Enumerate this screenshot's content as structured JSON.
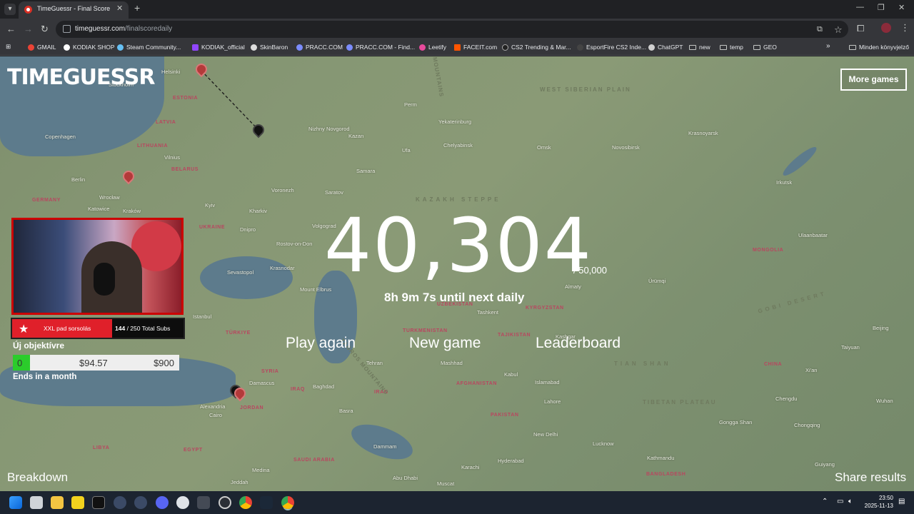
{
  "browser": {
    "tab_title": "TimeGuessr - Final Score",
    "url_host": "timeguessr.com",
    "url_path": "/finalscoredaily",
    "new_tab_icon": "plus-icon",
    "bookmarks": [
      {
        "label": "GMAIL",
        "icon": "gmail-icon"
      },
      {
        "label": "KODIAK SHOP",
        "icon": "shop-icon"
      },
      {
        "label": "Steam Community...",
        "icon": "steam-icon"
      },
      {
        "label": "KODIAK_official",
        "icon": "twitch-icon"
      },
      {
        "label": "SkinBaron",
        "icon": "skinbaron-icon"
      },
      {
        "label": "PRACC.COM",
        "icon": "pracc-icon"
      },
      {
        "label": "PRACC.COM - Find...",
        "icon": "pracc-icon"
      },
      {
        "label": "Leetify",
        "icon": "leetify-icon"
      },
      {
        "label": "FACEIT.com",
        "icon": "faceit-icon"
      },
      {
        "label": "CS2 Trending & Mar...",
        "icon": "cs2-icon"
      },
      {
        "label": "EsportFire CS2 Inde...",
        "icon": "esportfire-icon"
      },
      {
        "label": "ChatGPT",
        "icon": "chatgpt-icon"
      },
      {
        "label": "new",
        "icon": "folder-icon"
      },
      {
        "label": "temp",
        "icon": "folder-icon"
      },
      {
        "label": "GEO",
        "icon": "folder-icon"
      }
    ],
    "other_bookmarks": "Minden könyvjelző"
  },
  "page": {
    "logo": "TIMEGUESSR",
    "more_games": "More games",
    "score": "40,304",
    "score_max": "/ 50,000",
    "countdown": "8h 9m 7s until next daily",
    "actions": {
      "play_again": "Play again",
      "new_game": "New game",
      "leaderboard": "Leaderboard"
    },
    "breakdown": "Breakdown",
    "share": "Share results"
  },
  "map_labels": [
    {
      "text": "Helsinki",
      "kind": "city"
    },
    {
      "text": "Stockholm",
      "kind": "city"
    },
    {
      "text": "ESTONIA",
      "kind": "country"
    },
    {
      "text": "LATVIA",
      "kind": "country"
    },
    {
      "text": "LITHUANIA",
      "kind": "country"
    },
    {
      "text": "Vilnius",
      "kind": "city"
    },
    {
      "text": "Copenhagen",
      "kind": "city"
    },
    {
      "text": "Berlin",
      "kind": "city"
    },
    {
      "text": "BELARUS",
      "kind": "country"
    },
    {
      "text": "Wrocław",
      "kind": "city"
    },
    {
      "text": "Katowice",
      "kind": "city"
    },
    {
      "text": "Kraków",
      "kind": "city"
    },
    {
      "text": "GERMANY",
      "kind": "country"
    },
    {
      "text": "Kyiv",
      "kind": "city"
    },
    {
      "text": "Kharkiv",
      "kind": "city"
    },
    {
      "text": "UKRAINE",
      "kind": "country"
    },
    {
      "text": "Dnipro",
      "kind": "city"
    },
    {
      "text": "Rostov-on-Don",
      "kind": "city"
    },
    {
      "text": "Sevastopol",
      "kind": "city"
    },
    {
      "text": "Krasnodar",
      "kind": "city"
    },
    {
      "text": "Istanbul",
      "kind": "city"
    },
    {
      "text": "TÜRKIYE",
      "kind": "country"
    },
    {
      "text": "Mount Elbrus",
      "kind": "city"
    },
    {
      "text": "Nizhny Novgorod",
      "kind": "city"
    },
    {
      "text": "Kazan",
      "kind": "city"
    },
    {
      "text": "Perm",
      "kind": "city"
    },
    {
      "text": "Yekaterinburg",
      "kind": "city"
    },
    {
      "text": "Ufa",
      "kind": "city"
    },
    {
      "text": "Chelyabinsk",
      "kind": "city"
    },
    {
      "text": "Samara",
      "kind": "city"
    },
    {
      "text": "Voronezh",
      "kind": "city"
    },
    {
      "text": "Saratov",
      "kind": "city"
    },
    {
      "text": "Volgograd",
      "kind": "city"
    },
    {
      "text": "Omsk",
      "kind": "city"
    },
    {
      "text": "Novosibirsk",
      "kind": "city"
    },
    {
      "text": "Krasnoyarsk",
      "kind": "city"
    },
    {
      "text": "Irkutsk",
      "kind": "city"
    },
    {
      "text": "Ulaanbaatar",
      "kind": "city"
    },
    {
      "text": "MONGOLIA",
      "kind": "country"
    },
    {
      "text": "Ürümqi",
      "kind": "city"
    },
    {
      "text": "Almaty",
      "kind": "city"
    },
    {
      "text": "KYRGYZSTAN",
      "kind": "country"
    },
    {
      "text": "UZBEKISTAN",
      "kind": "country"
    },
    {
      "text": "Tashkent",
      "kind": "city"
    },
    {
      "text": "TURKMENISTAN",
      "kind": "country"
    },
    {
      "text": "TAJIKISTAN",
      "kind": "country"
    },
    {
      "text": "Kashgar",
      "kind": "city"
    },
    {
      "text": "Beijing",
      "kind": "city"
    },
    {
      "text": "Taiyuan",
      "kind": "city"
    },
    {
      "text": "Xi'an",
      "kind": "city"
    },
    {
      "text": "CHINA",
      "kind": "country"
    },
    {
      "text": "Chengdu",
      "kind": "city"
    },
    {
      "text": "Chongqing",
      "kind": "city"
    },
    {
      "text": "Wuhan",
      "kind": "city"
    },
    {
      "text": "Guiyang",
      "kind": "city"
    },
    {
      "text": "Gongga Shan",
      "kind": "city"
    },
    {
      "text": "Tehran",
      "kind": "city"
    },
    {
      "text": "Mashhad",
      "kind": "city"
    },
    {
      "text": "Kabul",
      "kind": "city"
    },
    {
      "text": "Islamabad",
      "kind": "city"
    },
    {
      "text": "Lahore",
      "kind": "city"
    },
    {
      "text": "AFGHANISTAN",
      "kind": "country"
    },
    {
      "text": "PAKISTAN",
      "kind": "country"
    },
    {
      "text": "IRAN",
      "kind": "country"
    },
    {
      "text": "IRAQ",
      "kind": "country"
    },
    {
      "text": "Baghdad",
      "kind": "city"
    },
    {
      "text": "SYRIA",
      "kind": "country"
    },
    {
      "text": "Damascus",
      "kind": "city"
    },
    {
      "text": "Alexandria",
      "kind": "city"
    },
    {
      "text": "Cairo",
      "kind": "city"
    },
    {
      "text": "JORDAN",
      "kind": "country"
    },
    {
      "text": "EGYPT",
      "kind": "country"
    },
    {
      "text": "LIBYA",
      "kind": "country"
    },
    {
      "text": "Basra",
      "kind": "city"
    },
    {
      "text": "Dammam",
      "kind": "city"
    },
    {
      "text": "Medina",
      "kind": "city"
    },
    {
      "text": "Jeddah",
      "kind": "city"
    },
    {
      "text": "SAUDI ARABIA",
      "kind": "country"
    },
    {
      "text": "Karachi",
      "kind": "city"
    },
    {
      "text": "New Delhi",
      "kind": "city"
    },
    {
      "text": "Lucknow",
      "kind": "city"
    },
    {
      "text": "Hyderabad",
      "kind": "city"
    },
    {
      "text": "Abu Dhabi",
      "kind": "city"
    },
    {
      "text": "Kathmandu",
      "kind": "city"
    },
    {
      "text": "BANGLADESH",
      "kind": "country"
    },
    {
      "text": "Muscat",
      "kind": "city"
    },
    {
      "text": "KAZAKH STEPPE",
      "kind": "region"
    },
    {
      "text": "WEST SIBERIAN PLAIN",
      "kind": "region"
    },
    {
      "text": "GOBI DESERT",
      "kind": "region"
    },
    {
      "text": "TIBETAN PLATEAU",
      "kind": "region"
    },
    {
      "text": "ZAGROS MOUNTAINS",
      "kind": "region"
    },
    {
      "text": "URAL MOUNTAINS",
      "kind": "region"
    },
    {
      "text": "TIAN SHAN",
      "kind": "region"
    }
  ],
  "overlay": {
    "subs_label": "XXL pad sorsolás",
    "subs_count": "144",
    "subs_total": "/ 250 Total Subs",
    "goal_title": "Új objektívre",
    "goal_current": "0",
    "goal_amount": "$94.57",
    "goal_max": "$900",
    "goal_progress": 0.105,
    "goal_end": "Ends in a month"
  },
  "taskbar": {
    "time": "23:50",
    "date": "2025-11-13"
  },
  "colors": {
    "map_base": "#869774",
    "water": "#5d7b8c",
    "pin_red": "#b33a3a",
    "subs_red": "#e0202a",
    "goal_green": "#2bcc2b"
  }
}
